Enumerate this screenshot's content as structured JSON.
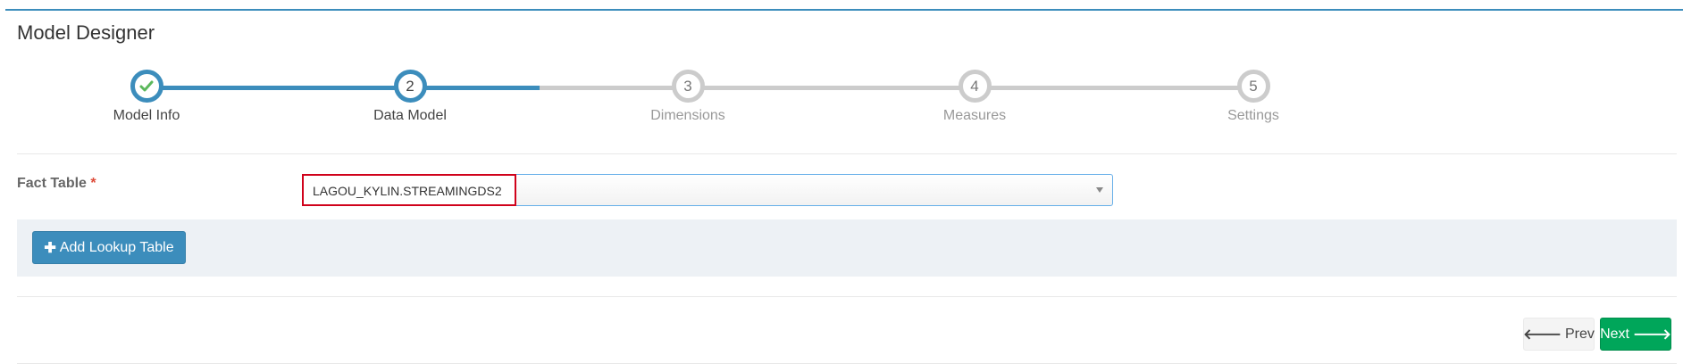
{
  "header": {
    "title": "Model Designer"
  },
  "wizard": {
    "steps": [
      {
        "label": "Model Info",
        "number": "",
        "state": "done",
        "icon": "check-icon"
      },
      {
        "label": "Data Model",
        "number": "2",
        "state": "active"
      },
      {
        "label": "Dimensions",
        "number": "3",
        "state": "todo"
      },
      {
        "label": "Measures",
        "number": "4",
        "state": "todo"
      },
      {
        "label": "Settings",
        "number": "5",
        "state": "todo"
      }
    ],
    "done_color": "#3c8dbc",
    "todo_color": "#cccccc",
    "check_color": "#5cb85c"
  },
  "form": {
    "fact_table_label": "Fact Table",
    "required_mark": "*",
    "fact_table_value": "LAGOU_KYLIN.STREAMINGDS2"
  },
  "lookup": {
    "add_button_label": "Add Lookup Table",
    "add_icon": "plus-icon"
  },
  "footer": {
    "prev_label": "Prev",
    "prev_icon": "arrow-left-icon",
    "next_label": "Next",
    "next_icon": "arrow-right-icon"
  }
}
